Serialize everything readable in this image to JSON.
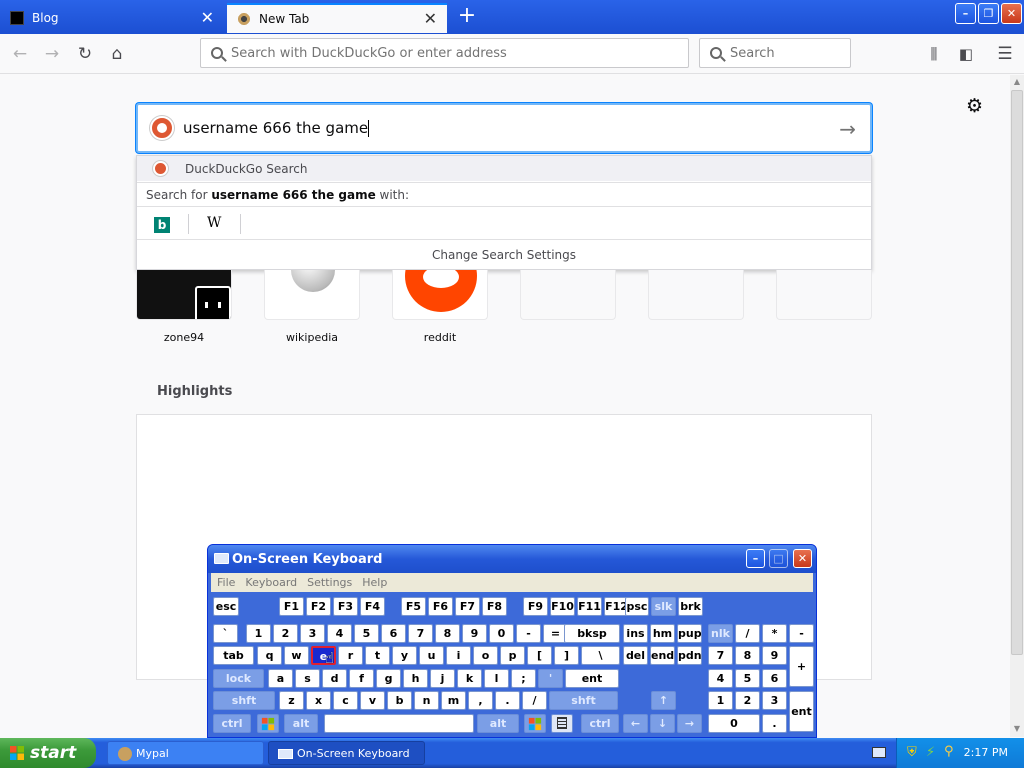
{
  "browser": {
    "tabs": [
      {
        "title": "Blog",
        "active": false
      },
      {
        "title": "New Tab",
        "active": true
      }
    ],
    "new_tab_symbol": "+",
    "close_symbol": "✕",
    "window_controls": {
      "minimize": "–",
      "restore": "❐",
      "close": "✕"
    },
    "urlbar_placeholder": "Search with DuckDuckGo or enter address",
    "searchbar_placeholder": "Search"
  },
  "newtab": {
    "search_text": "username 666 the game",
    "dropdown": {
      "engine_row": "DuckDuckGo Search",
      "search_for_prefix": "Search for ",
      "search_for_query": "username 666 the game",
      "search_for_suffix": " with:",
      "engines": [
        "bing-icon",
        "wikipedia-icon"
      ],
      "wiki_glyph": "W",
      "bing_glyph": "b",
      "change_settings": "Change Search Settings"
    },
    "top_sites": [
      {
        "label": "zone94"
      },
      {
        "label": "wikipedia"
      },
      {
        "label": "reddit"
      }
    ],
    "highlights_title": "Highlights"
  },
  "osk": {
    "title": "On-Screen Keyboard",
    "menu": [
      "File",
      "Keyboard",
      "Settings",
      "Help"
    ],
    "rows": [
      [
        "esc",
        "F1",
        "F2",
        "F3",
        "F4",
        "F5",
        "F6",
        "F7",
        "F8",
        "F9",
        "F10",
        "F11",
        "F12",
        "psc",
        "slk",
        "brk"
      ],
      [
        "`",
        "1",
        "2",
        "3",
        "4",
        "5",
        "6",
        "7",
        "8",
        "9",
        "0",
        "-",
        "=",
        "bksp",
        "ins",
        "hm",
        "pup",
        "nlk",
        "/",
        "*",
        "-"
      ],
      [
        "tab",
        "q",
        "w",
        "e",
        "r",
        "t",
        "y",
        "u",
        "i",
        "o",
        "p",
        "[",
        "]",
        "\\",
        "del",
        "end",
        "pdn",
        "7",
        "8",
        "9",
        "+"
      ],
      [
        "lock",
        "a",
        "s",
        "d",
        "f",
        "g",
        "h",
        "j",
        "k",
        "l",
        ";",
        "'",
        "ent",
        "4",
        "5",
        "6"
      ],
      [
        "shft",
        "z",
        "x",
        "c",
        "v",
        "b",
        "n",
        "m",
        ",",
        ".",
        "/",
        "shft",
        "↑",
        "1",
        "2",
        "3",
        "ent"
      ],
      [
        "ctrl",
        "win",
        "alt",
        "",
        "alt",
        "win",
        "menu",
        "ctrl",
        "←",
        "↓",
        "→",
        "0",
        "."
      ]
    ],
    "active_key": "e"
  },
  "taskbar": {
    "start_label": "start",
    "tasks": [
      "Mypal",
      "On-Screen Keyboard"
    ],
    "clock": "2:17 PM"
  }
}
